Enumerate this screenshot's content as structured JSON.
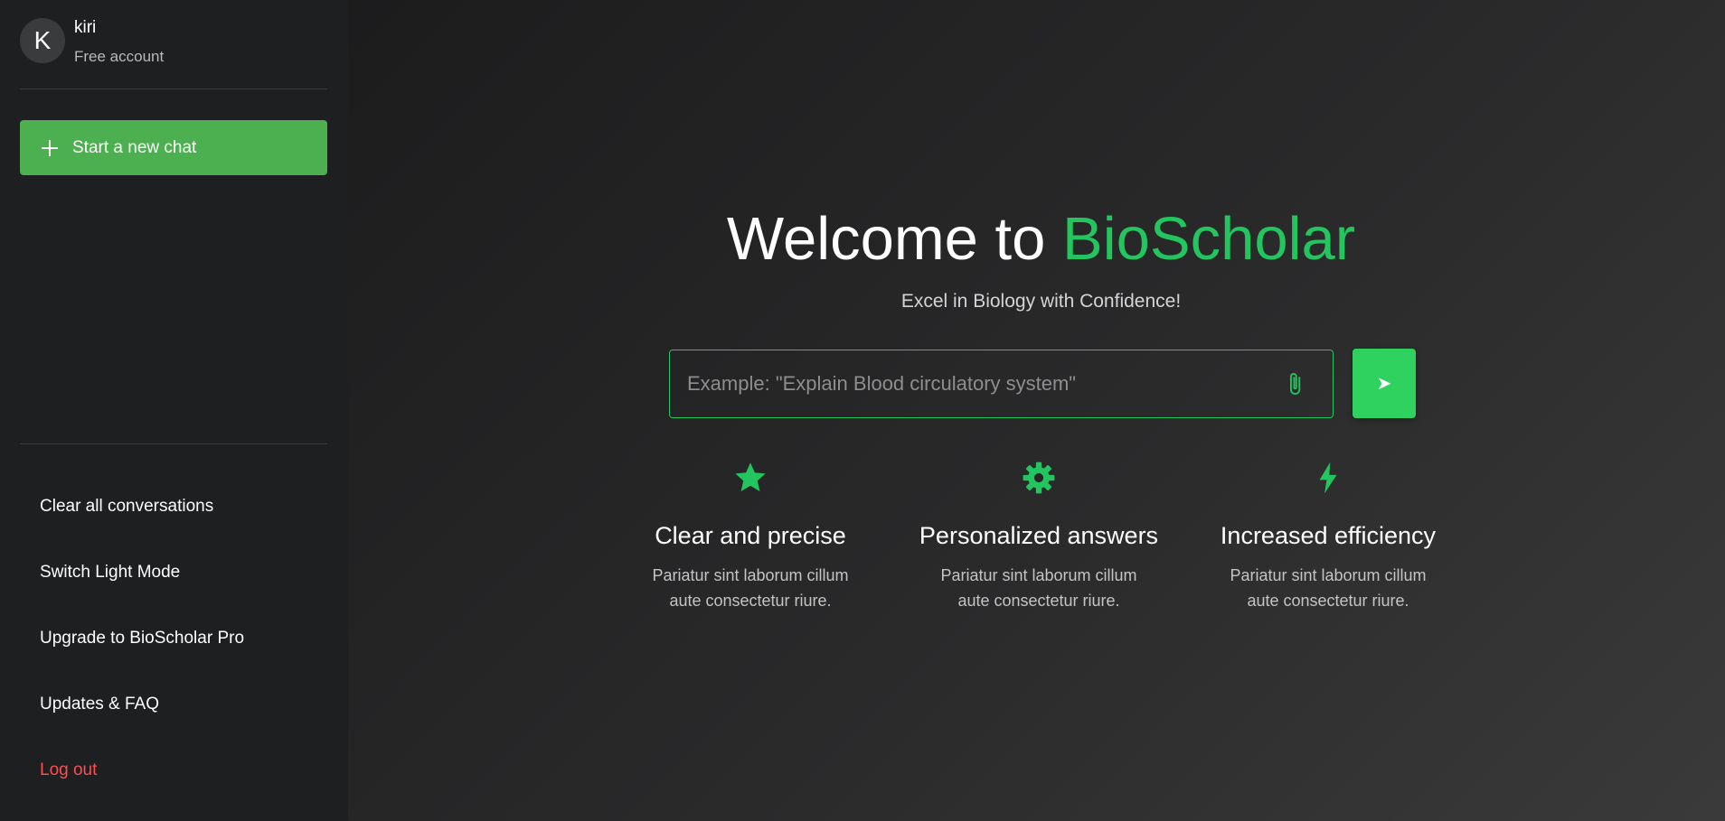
{
  "user": {
    "avatar_initial": "K",
    "name": "kiri",
    "plan": "Free account"
  },
  "sidebar": {
    "new_chat_label": "Start a new chat",
    "menu": [
      {
        "label": "Clear all conversations"
      },
      {
        "label": "Switch Light Mode"
      },
      {
        "label": "Upgrade to BioScholar Pro"
      },
      {
        "label": "Updates & FAQ"
      },
      {
        "label": "Log out"
      }
    ]
  },
  "hero": {
    "title_prefix": "Welcome to ",
    "title_brand": "BioScholar",
    "subtitle": "Excel in Biology with Confidence!"
  },
  "search": {
    "placeholder": "Example: \"Explain Blood circulatory system\"",
    "value": ""
  },
  "features": [
    {
      "icon": "star-icon",
      "title": "Clear and precise",
      "desc": "Pariatur sint laborum cillum aute consectetur riure."
    },
    {
      "icon": "gear-icon",
      "title": "Personalized answers",
      "desc": "Pariatur sint laborum cillum aute consectetur riure."
    },
    {
      "icon": "lightning-icon",
      "title": "Increased efficiency",
      "desc": "Pariatur sint laborum cillum aute consectetur riure."
    }
  ],
  "colors": {
    "accent": "#22c55e",
    "button_green": "#4caf50",
    "send_green": "#2fd15f",
    "logout_red": "#ff4d4f"
  }
}
